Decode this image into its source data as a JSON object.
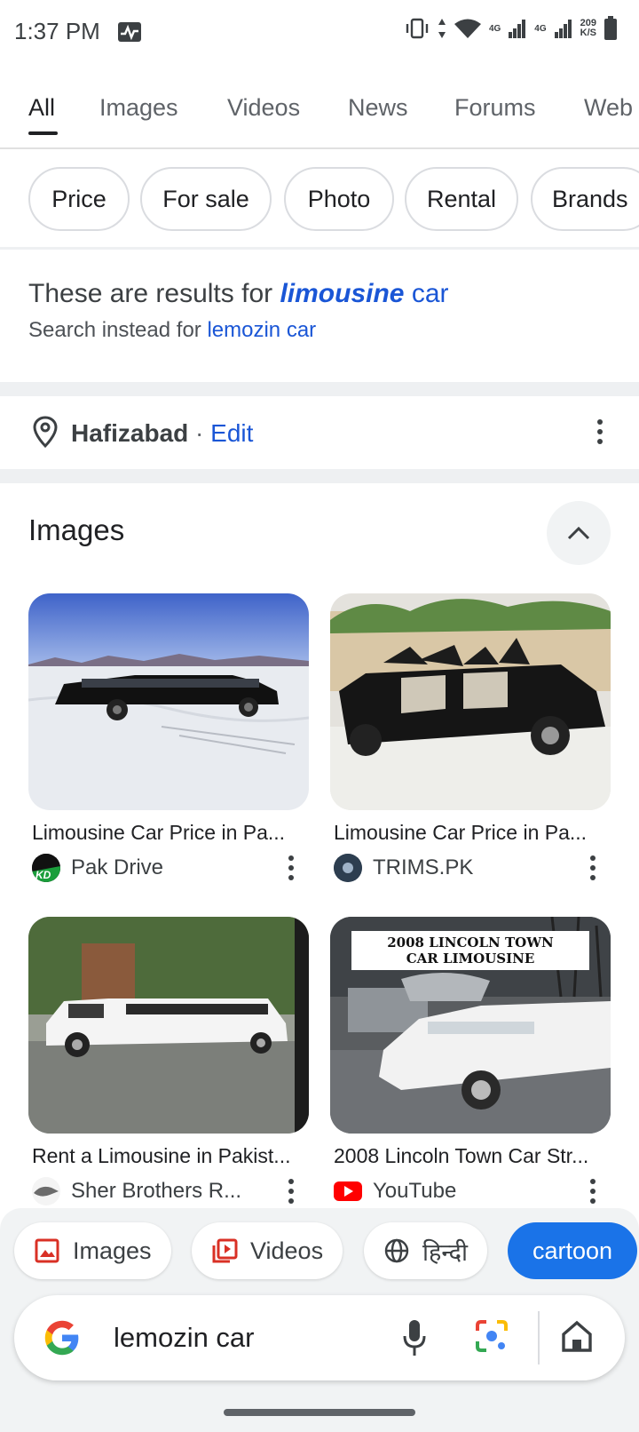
{
  "status_bar": {
    "time": "1:37 PM",
    "net_speed_value": "209",
    "net_speed_unit": "K/S",
    "signal_label_1": "4G",
    "signal_label_2": "4G"
  },
  "tabs": [
    "All",
    "Images",
    "Videos",
    "News",
    "Forums",
    "Web"
  ],
  "active_tab": "All",
  "chips": [
    "Price",
    "For sale",
    "Photo",
    "Rental",
    "Brands"
  ],
  "correction": {
    "prefix": "These are results for ",
    "corrected_word": "limousine",
    "corrected_rest": " car",
    "instead_prefix": "Search instead for ",
    "instead_query": "lemozin car"
  },
  "location": {
    "city": "Hafizabad",
    "separator": " · ",
    "edit_label": "Edit"
  },
  "images_section": {
    "title": "Images",
    "results": [
      {
        "title": "Limousine Car Price in Pa...",
        "source": "Pak Drive",
        "source_icon": "pakdrive-logo"
      },
      {
        "title": "Limousine Car Price in Pa...",
        "source": "TRIMS.PK",
        "source_icon": "trims-logo"
      },
      {
        "title": "Rent a Limousine in Pakist...",
        "source": "Sher Brothers R...",
        "source_icon": "sherbrothers-logo"
      },
      {
        "title": "2008 Lincoln Town Car Str...",
        "source": "YouTube",
        "source_icon": "youtube-logo",
        "thumb_caption_1": "2008 LINCOLN TOWN",
        "thumb_caption_2": "CAR LIMOUSINE"
      }
    ]
  },
  "bottom_suggestions": [
    {
      "label": "Images",
      "icon": "image-icon"
    },
    {
      "label": "Videos",
      "icon": "video-icon"
    },
    {
      "label": "हिन्दी",
      "icon": "globe-icon"
    },
    {
      "label": "cartoon",
      "icon": ""
    }
  ],
  "search_bar": {
    "query": "lemozin car"
  },
  "colors": {
    "link_blue": "#1a56d6",
    "accent": "#1a73e8",
    "youtube_red": "#ff0000"
  }
}
